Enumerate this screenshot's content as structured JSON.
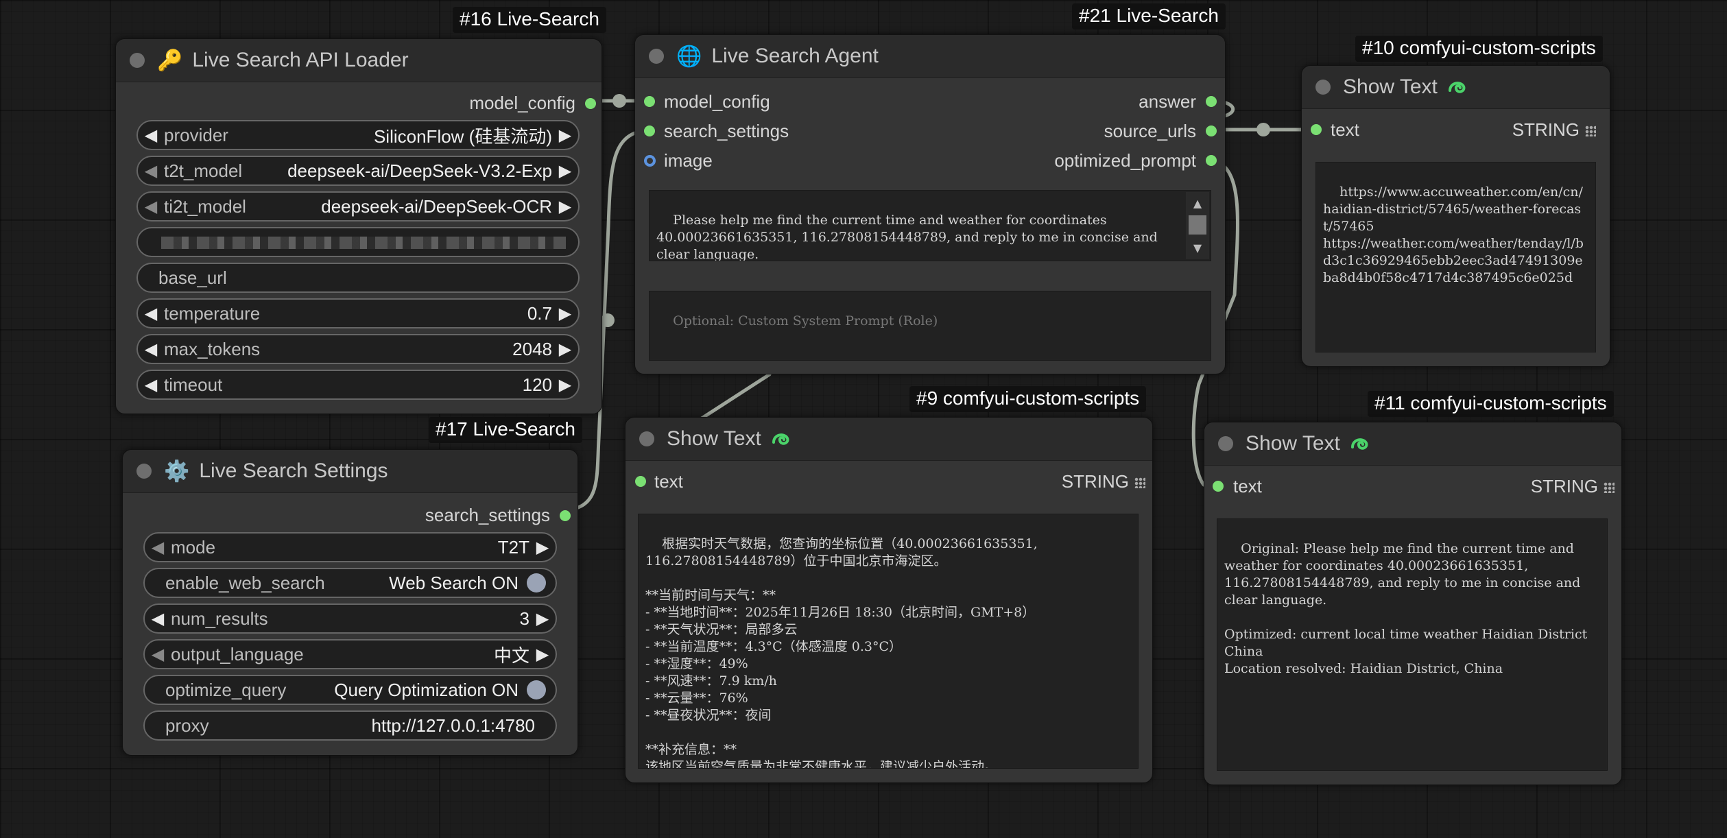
{
  "badges": {
    "n16": "#16 Live-Search",
    "n21": "#21 Live-Search",
    "n10": "#10 comfyui-custom-scripts",
    "n17": "#17 Live-Search",
    "n9": "#9 comfyui-custom-scripts",
    "n11": "#11 comfyui-custom-scripts"
  },
  "loader": {
    "title": "Live Search API Loader",
    "icon": "key-icon",
    "output": "model_config",
    "widgets": {
      "provider": {
        "name": "provider",
        "value": "SiliconFlow (硅基流动)"
      },
      "t2t_model": {
        "name": "t2t_model",
        "value": "deepseek-ai/DeepSeek-V3.2-Exp"
      },
      "ti2t_model": {
        "name": "ti2t_model",
        "value": "deepseek-ai/DeepSeek-OCR"
      },
      "base_url": {
        "name": "base_url"
      },
      "temperature": {
        "name": "temperature",
        "value": "0.7"
      },
      "max_tokens": {
        "name": "max_tokens",
        "value": "2048"
      },
      "timeout": {
        "name": "timeout",
        "value": "120"
      }
    }
  },
  "settings": {
    "title": "Live Search Settings",
    "icon": "gear-icon",
    "output": "search_settings",
    "widgets": {
      "mode": {
        "name": "mode",
        "value": "T2T"
      },
      "enable_web_search": {
        "name": "enable_web_search",
        "value": "Web Search ON"
      },
      "num_results": {
        "name": "num_results",
        "value": "3"
      },
      "output_language": {
        "name": "output_language",
        "value": "中文"
      },
      "optimize_query": {
        "name": "optimize_query",
        "value": "Query Optimization ON"
      },
      "proxy": {
        "name": "proxy",
        "value": "http://127.0.0.1:4780"
      }
    }
  },
  "agent": {
    "title": "Live Search Agent",
    "icon": "globe-icon",
    "inputs": [
      "model_config",
      "search_settings",
      "image"
    ],
    "outputs": [
      "answer",
      "source_urls",
      "optimized_prompt"
    ],
    "prompt": "Please help me find the current time and weather for coordinates 40.00023661635351, 116.27808154448789, and reply to me in concise and clear language.",
    "system_placeholder": "Optional: Custom System Prompt (Role)"
  },
  "show10": {
    "title": "Show Text",
    "input": "text",
    "type": "STRING",
    "content": "https://www.accuweather.com/en/cn/haidian-district/57465/weather-forecast/57465\nhttps://weather.com/weather/tenday/l/bd3c1c36929465ebb2eec3ad47491309eba8d4b0f58c4717d4c387495c6e025d"
  },
  "show9": {
    "title": "Show Text",
    "input": "text",
    "type": "STRING",
    "content": "根据实时天气数据，您查询的坐标位置（40.00023661635351,\n116.27808154448789）位于中国北京市海淀区。\n\n**当前时间与天气：**\n- **当地时间**：2025年11月26日 18:30（北京时间，GMT+8）\n- **天气状况**：局部多云\n- **当前温度**：4.3°C（体感温度 0.3°C）\n- **湿度**：49%\n- **风速**：7.9 km/h\n- **云量**：76%\n- **昼夜状况**：夜间\n\n**补充信息：**\n该地区当前空气质量为非常不健康水平，建议减少户外活动。"
  },
  "show11": {
    "title": "Show Text",
    "input": "text",
    "type": "STRING",
    "content": "Original: Please help me find the current time and weather for coordinates 40.00023661635351, 116.27808154448789, and reply to me in concise and clear language.\n\nOptimized: current local time weather Haidian District China\nLocation resolved: Haidian District, China"
  },
  "colors": {
    "pin_connected": "#7be073",
    "pin_image": "#5c93df",
    "link": "#9fa69c",
    "ccs_icon": "#4bd36a"
  }
}
